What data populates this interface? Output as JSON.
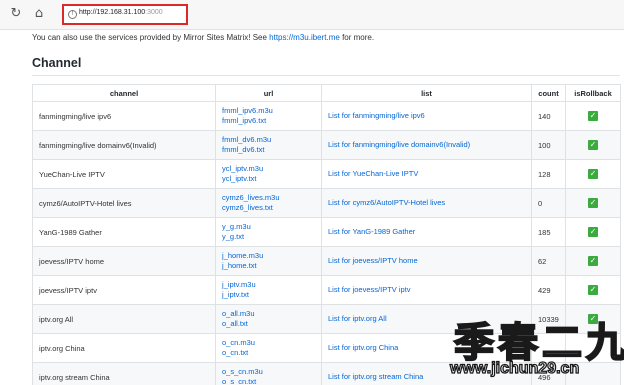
{
  "browser": {
    "reload_icon": "reload-icon",
    "home_icon": "home-icon",
    "address": {
      "host": "http://192.168.31.100",
      "port": ":3000"
    }
  },
  "intro": {
    "text_before": "You can also use the services provided by Mirror Sites Matrix! See ",
    "link": "https://m3u.ibert.me",
    "text_after": " for more."
  },
  "heading": "Channel",
  "table": {
    "headers": [
      "channel",
      "url",
      "list",
      "count",
      "isRollback"
    ],
    "rows": [
      {
        "channel": "fanmingming/live ipv6",
        "url1": "fmml_ipv6.m3u",
        "url2": "fmml_ipv6.txt",
        "list": "List for fanmingming/live ipv6",
        "count": "140",
        "rollback": "✓"
      },
      {
        "channel": "fanmingming/live domainv6(Invalid)",
        "url1": "fmml_dv6.m3u",
        "url2": "fmml_dv6.txt",
        "list": "List for fanmingming/live domainv6(Invalid)",
        "count": "100",
        "rollback": "✓"
      },
      {
        "channel": "YueChan-Live IPTV",
        "url1": "ycl_iptv.m3u",
        "url2": "ycl_iptv.txt",
        "list": "List for YueChan-Live IPTV",
        "count": "128",
        "rollback": "✓"
      },
      {
        "channel": "cymz6/AutoIPTV-Hotel lives",
        "url1": "cymz6_lives.m3u",
        "url2": "cymz6_lives.txt",
        "list": "List for cymz6/AutoIPTV-Hotel lives",
        "count": "0",
        "rollback": "✓"
      },
      {
        "channel": "YanG-1989 Gather",
        "url1": "y_g.m3u",
        "url2": "y_g.txt",
        "list": "List for YanG-1989 Gather",
        "count": "185",
        "rollback": "✓"
      },
      {
        "channel": "joevess/IPTV home",
        "url1": "j_home.m3u",
        "url2": "j_home.txt",
        "list": "List for joevess/IPTV home",
        "count": "62",
        "rollback": "✓"
      },
      {
        "channel": "joevess/IPTV iptv",
        "url1": "j_iptv.m3u",
        "url2": "j_iptv.txt",
        "list": "List for joevess/IPTV iptv",
        "count": "429",
        "rollback": "✓"
      },
      {
        "channel": "iptv.org All",
        "url1": "o_all.m3u",
        "url2": "o_all.txt",
        "list": "List for iptv.org All",
        "count": "10339",
        "rollback": "✓"
      },
      {
        "channel": "iptv.org China",
        "url1": "o_cn.m3u",
        "url2": "o_cn.txt",
        "list": "List for iptv.org China",
        "count": "",
        "rollback": ""
      },
      {
        "channel": "iptv.org stream China",
        "url1": "o_s_cn.m3u",
        "url2": "o_s_cn.txt",
        "list": "List for iptv.org stream China",
        "count": "496",
        "rollback": ""
      }
    ]
  },
  "watermark": {
    "cn": "季春二九",
    "url": "www.jichun29.cn"
  },
  "colors": {
    "link": "#0366d6",
    "check": "#3bab3f",
    "highlight_box": "#d9292b"
  }
}
